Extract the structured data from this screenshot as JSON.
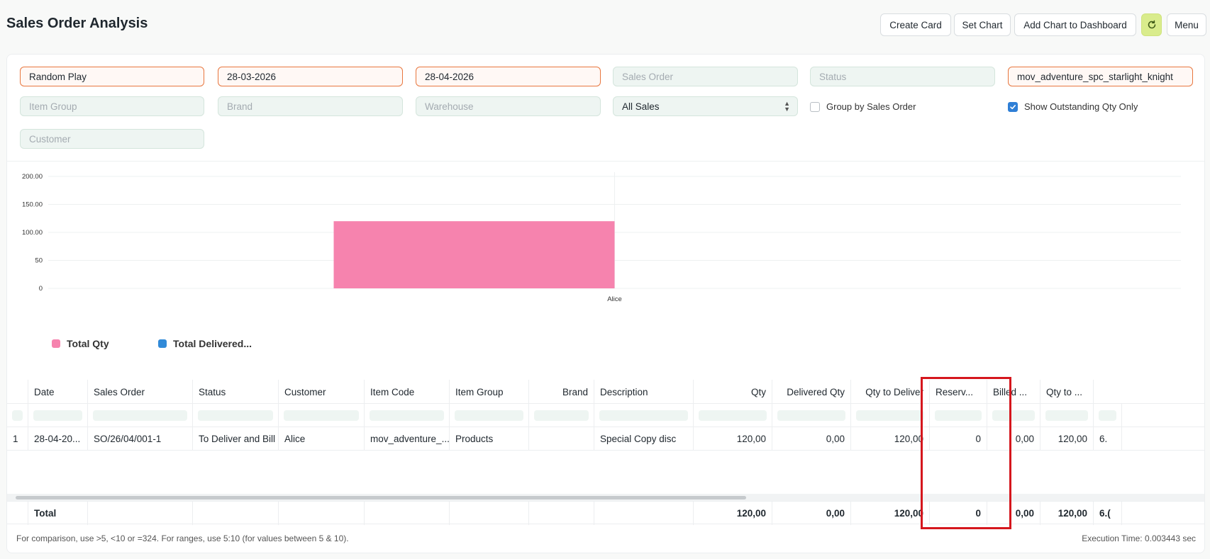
{
  "header": {
    "title": "Sales Order Analysis",
    "buttons": {
      "create_card": "Create Card",
      "set_chart": "Set Chart",
      "add_chart": "Add Chart to Dashboard",
      "refresh_icon": "refresh-icon",
      "menu": "Menu"
    }
  },
  "filters": {
    "company": "Random Play",
    "from_date": "28-03-2026",
    "to_date": "28-04-2026",
    "sales_order_placeholder": "Sales Order",
    "status_placeholder": "Status",
    "item_code": "mov_adventure_spc_starlight_knight",
    "item_group_placeholder": "Item Group",
    "brand_placeholder": "Brand",
    "warehouse_placeholder": "Warehouse",
    "sales_type": "All Sales",
    "group_by_sales_order": "Group by Sales Order",
    "group_by_checked": false,
    "show_outstanding": "Show Outstanding Qty Only",
    "show_outstanding_checked": true,
    "customer_placeholder": "Customer"
  },
  "chart_data": {
    "type": "bar",
    "categories": [
      "Alice"
    ],
    "series": [
      {
        "name": "Total Qty",
        "values": [
          120
        ],
        "color": "#f683ae"
      },
      {
        "name": "Total Delivered...",
        "values": [
          0
        ],
        "color": "#318ad8"
      }
    ],
    "yticks": [
      "0",
      "50",
      "100.00",
      "150.00",
      "200.00"
    ],
    "ylim": [
      0,
      200
    ],
    "grid": true,
    "legend_position": "bottom-left"
  },
  "table": {
    "columns": [
      "Date",
      "Sales Order",
      "Status",
      "Customer",
      "Item Code",
      "Item Group",
      "Brand",
      "Description",
      "Qty",
      "Delivered Qty",
      "Qty to Deliver",
      "Reserv...",
      "Billed ...",
      "Qty to ..."
    ],
    "rows": [
      {
        "index": "1",
        "cells": [
          "28-04-20...",
          "SO/26/04/001-1",
          "To Deliver and Bill",
          "Alice",
          "mov_adventure_...",
          "Products",
          "",
          "Special Copy disc",
          "120,00",
          "0,00",
          "120,00",
          "0",
          "0,00",
          "120,00",
          "6."
        ]
      }
    ],
    "total": {
      "label": "Total",
      "cells": [
        "",
        "",
        "",
        "",
        "",
        "",
        "",
        "120,00",
        "0,00",
        "120,00",
        "0",
        "0,00",
        "120,00",
        "6.("
      ]
    }
  },
  "footer": {
    "note": "For comparison, use >5, <10 or =324. For ranges, use 5:10 (for values between 5 & 10).",
    "execution_time": "Execution Time: 0.003443 sec"
  }
}
